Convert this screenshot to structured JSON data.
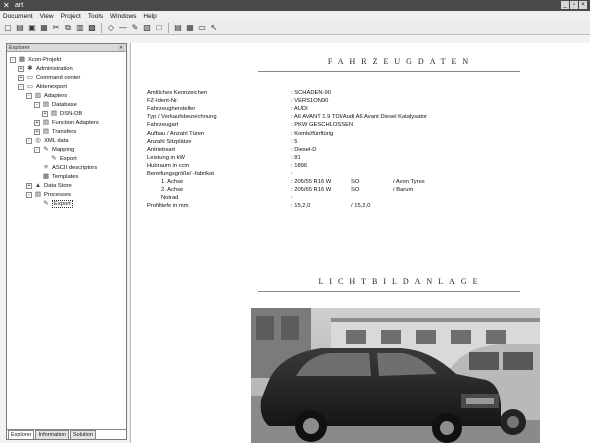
{
  "window": {
    "title": "art"
  },
  "menu": [
    "Document",
    "View",
    "Project",
    "Tools",
    "Windows",
    "Help"
  ],
  "toolbar_icons": [
    "new-icon",
    "open-icon",
    "save-icon",
    "save-as-icon",
    "cut-icon",
    "copy-icon",
    "paste-icon",
    "print-icon",
    "diamond-icon",
    "minus-icon",
    "edit-icon",
    "preview-icon",
    "frame-icon",
    "layout-icon",
    "grid-icon",
    "window-icon",
    "pointer-icon"
  ],
  "explorer": {
    "header": "Explorer",
    "tree": [
      {
        "label": "Xcon-Projekt",
        "depth": 0,
        "exp": "-",
        "icon": "project-icon"
      },
      {
        "label": "Administration",
        "depth": 1,
        "exp": "+",
        "icon": "admin-icon"
      },
      {
        "label": "Command center",
        "depth": 1,
        "exp": "+",
        "icon": "command-icon"
      },
      {
        "label": "Aktenexport",
        "depth": 1,
        "exp": "-",
        "icon": "folder-icon"
      },
      {
        "label": "Adapters",
        "depth": 2,
        "exp": "-",
        "icon": "adapter-icon"
      },
      {
        "label": "Database",
        "depth": 3,
        "exp": "-",
        "icon": "database-icon"
      },
      {
        "label": "DSN-DB",
        "depth": 4,
        "exp": "+",
        "icon": "db-icon"
      },
      {
        "label": "Function Adapters",
        "depth": 3,
        "exp": "+",
        "icon": "function-icon"
      },
      {
        "label": "Transfers",
        "depth": 3,
        "exp": "+",
        "icon": "transfer-icon"
      },
      {
        "label": "XML data",
        "depth": 2,
        "exp": "-",
        "icon": "xml-icon"
      },
      {
        "label": "Mapping",
        "depth": 3,
        "exp": "-",
        "icon": "mapping-icon"
      },
      {
        "label": "Export",
        "depth": 4,
        "exp": "",
        "icon": "export-icon"
      },
      {
        "label": "ASCII descriptors",
        "depth": 3,
        "exp": "",
        "icon": "ascii-icon"
      },
      {
        "label": "Templates",
        "depth": 3,
        "exp": "",
        "icon": "template-icon"
      },
      {
        "label": "Data Store",
        "depth": 2,
        "exp": "+",
        "icon": "datastore-icon"
      },
      {
        "label": "Processes",
        "depth": 2,
        "exp": "-",
        "icon": "process-icon"
      },
      {
        "label": "Export",
        "depth": 3,
        "exp": "",
        "icon": "export-icon",
        "selected": true
      }
    ],
    "tabs": [
      "Explorer",
      "Information",
      "Solution"
    ]
  },
  "document": {
    "heading1": "FAHRZEUGDATEN",
    "heading2": "LICHTBILDANLAGE",
    "fields": [
      {
        "label": "Amtliches Kennzeichen",
        "value": ": SCHADEN-90"
      },
      {
        "label": "FZ-Ident-Nr.",
        "value": ": VERS1ON90"
      },
      {
        "label": "Fahrzeughersteller",
        "value": ": AUDI"
      },
      {
        "label": "Typ / Verkaufsbezeichnung",
        "value": ": A6 AVANT 1.9 TDI/Audi A6 Avant Diesel Katalysator"
      },
      {
        "label": "Fahrzeugart",
        "value": ": PKW GESCHLOSSEN"
      },
      {
        "label": "Aufbau / Anzahl Türen",
        "value": ": Kombi/fünftürig"
      },
      {
        "label": "Anzahl Sitzplätze",
        "value": ": 5"
      },
      {
        "label": "Antriebsart",
        "value": ": Diesel-D"
      },
      {
        "label": "Leistung in kW",
        "value": ": 81"
      },
      {
        "label": "Hubraum in ccm",
        "value": ": 1896"
      },
      {
        "label": "Bereifungsgröße/ -fabrikat",
        "value": ":"
      }
    ],
    "tires": [
      {
        "label": "1. Achse",
        "size": ": 205/55 R16 W",
        "code": "SO",
        "brand": "/ Avon Tyres"
      },
      {
        "label": "2. Achse",
        "size": ": 205/65 R16 W",
        "code": "SO",
        "brand": "/ Barum"
      },
      {
        "label": "Notrad",
        "size": ":",
        "code": "",
        "brand": ""
      }
    ],
    "profile": {
      "label": "Profiltiefe in mm",
      "value1": ": 15,2,0",
      "value2": "/ 15,2,0"
    }
  }
}
